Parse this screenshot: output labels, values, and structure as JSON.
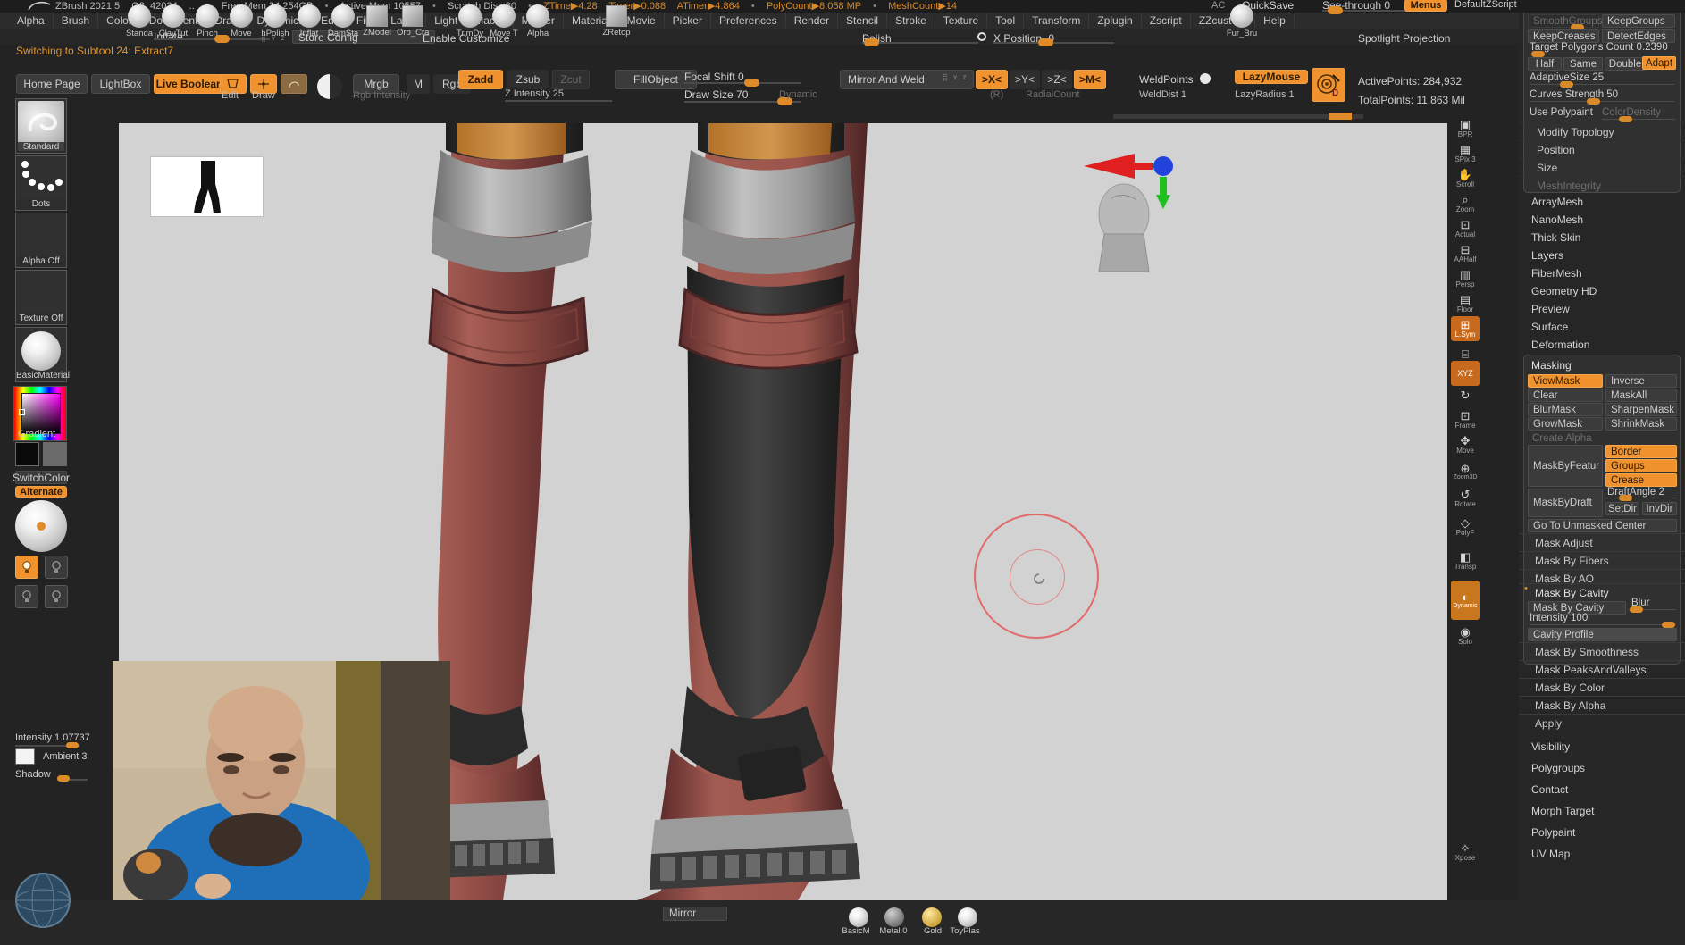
{
  "app": {
    "title_tokens": [
      "ZBrush 2021.5",
      "Q3_42024",
      "..",
      "Free Mem 34.254GB",
      "Active Mem 10557",
      "Scratch Disk 80",
      "ZTime▶4.28",
      "Timer▶0.088",
      "ATimer▶4.864",
      "PolyCount▶8.058 MP",
      "MeshCount▶14"
    ]
  },
  "menubar": {
    "items": [
      "Alpha",
      "Brush",
      "Color",
      "Document",
      "Draw",
      "Dynamics",
      "Edit",
      "File",
      "Layer",
      "Light",
      "Macro",
      "Marker",
      "Material",
      "Movie",
      "Picker",
      "Preferences",
      "Render",
      "Stencil",
      "Stroke",
      "Texture",
      "Tool",
      "Transform",
      "Zplugin",
      "Zscript",
      "ZZcustom",
      "Help"
    ]
  },
  "customrow": {
    "inflate_label": "Inflate",
    "store_config": "Store Config",
    "enable_customize": "Enable Customize",
    "polish_label": "Polish",
    "x_position_label": "X Position  -0",
    "spotlight_projection": "Spotlight Projection",
    "ac_label": "AC",
    "quicksave_label": "QuickSave",
    "see_through_label": "See-through  0",
    "menus_label": "Menus",
    "default_script_label": "DefaultZScript"
  },
  "status": {
    "message": "Switching to Subtool 24:  Extract7"
  },
  "toolbar2": {
    "home_page": "Home Page",
    "lightbox": "LightBox",
    "live_boolean": "Live Boolean",
    "edit_label": "Edit",
    "draw_label": "Draw",
    "mrgb": "Mrgb",
    "m": "M",
    "rgb": "Rgb",
    "zadd": "Zadd",
    "zsub": "Zsub",
    "zcut": "Zcut",
    "rgb_intensity": "Rgb Intensity",
    "z_intensity": "Z Intensity  25",
    "fill_object": "FillObject",
    "focal_shift": "Focal Shift  0",
    "draw_size": "Draw Size  70",
    "dynamic": "Dynamic",
    "mirror_and_weld": "Mirror And Weld",
    "axis_x": ">X<",
    "axis_y": ">Y<",
    "axis_z": ">Z<",
    "axis_m": ">M<",
    "r_label": "(R)",
    "radial_count": "RadialCount",
    "weld_points": "WeldPoints",
    "weld_dist": "WeldDist  1",
    "lazy_mouse": "LazyMouse",
    "lazy_radius": "LazyRadius  1",
    "active_points": "ActivePoints: 284,932",
    "total_points": "TotalPoints: 11.863 Mil"
  },
  "leftbar": {
    "brush_caption": "Standard",
    "stroke_caption": "Dots",
    "alpha_caption": "Alpha Off",
    "texture_caption": "Texture Off",
    "material_caption": "BasicMaterial",
    "gradient_caption": "Gradient",
    "switch_color": "SwitchColor",
    "alternate": "Alternate",
    "intensity": "Intensity  1.07737",
    "ambient": "Ambient  3",
    "shadow": "Shadow"
  },
  "rightstrip": {
    "items": [
      {
        "label": "BPR",
        "glyph": "▣"
      },
      {
        "label": "SPix 3",
        "glyph": "▦"
      },
      {
        "label": "Scroll",
        "glyph": "✋"
      },
      {
        "label": "Zoom",
        "glyph": "🔍"
      },
      {
        "label": "Actual",
        "glyph": "⊡"
      },
      {
        "label": "AAHalf",
        "glyph": "⊟"
      },
      {
        "label": "Persp",
        "glyph": "▥"
      },
      {
        "label": "Floor",
        "glyph": "▤"
      },
      {
        "label": "L.Sym",
        "glyph": "⊞",
        "on": true
      },
      {
        "label": "",
        "glyph": "🔒"
      },
      {
        "label": "XYZ",
        "glyph": "◎",
        "on": true
      },
      {
        "label": "",
        "glyph": "↻"
      },
      {
        "label": "Frame",
        "glyph": "⊡"
      },
      {
        "label": "Move",
        "glyph": "✥"
      },
      {
        "label": "Zoom3D",
        "glyph": "⊕"
      },
      {
        "label": "Rotate",
        "glyph": "↺"
      },
      {
        "label": "PolyF",
        "glyph": "◇"
      },
      {
        "label": "Transp",
        "glyph": "◧"
      },
      {
        "label": "Dynamic",
        "glyph": "◐"
      },
      {
        "label": "Solo",
        "glyph": "◉"
      },
      {
        "label": "Xpose",
        "glyph": "✧"
      }
    ]
  },
  "rightpanel": {
    "geometry": {
      "smooth_groups": "SmoothGroups",
      "keep_groups": "KeepGroups",
      "keep_creases": "KeepCreases",
      "detect_edges": "DetectEdges",
      "target_polygons_count": "Target Polygons Count  0.2390",
      "half": "Half",
      "same": "Same",
      "double": "Double",
      "adapt": "Adapt",
      "adaptive_size": "AdaptiveSize  25",
      "curves_strength": "Curves Strength  50",
      "use_polypaint": "Use Polypaint",
      "color_density": "ColorDensity",
      "modify_topology": "Modify Topology",
      "position": "Position",
      "size": "Size",
      "mesh_integrity": "MeshIntegrity"
    },
    "sections": [
      "ArrayMesh",
      "NanoMesh",
      "Thick Skin",
      "Layers",
      "FiberMesh",
      "Geometry HD",
      "Preview",
      "Surface",
      "Deformation"
    ],
    "masking": {
      "title": "Masking",
      "view_mask": "ViewMask",
      "inverse": "Inverse",
      "clear": "Clear",
      "mask_all": "MaskAll",
      "blur_mask": "BlurMask",
      "sharpen_mask": "SharpenMask",
      "grow_mask": "GrowMask",
      "shrink_mask": "ShrinkMask",
      "create_alpha": "Create Alpha",
      "mask_by_feature": "MaskByFeatur",
      "border": "Border",
      "groups": "Groups",
      "crease": "Crease",
      "mask_by_draft": "MaskByDraft",
      "draft_angle": "DraftAngle  2",
      "set_dir": "SetDir",
      "inv_dir": "InvDir",
      "go_to_unmasked_center": "Go To Unmasked Center",
      "mask_adjust": "Mask Adjust",
      "mask_by_fibers": "Mask By Fibers",
      "mask_by_ao": "Mask By AO",
      "mask_by_cavity_section": "Mask By Cavity",
      "mask_by_cavity_btn": "Mask By Cavity",
      "blur": "Blur",
      "intensity": "Intensity  100",
      "cavity_profile": "Cavity Profile",
      "mask_by_smoothness": "Mask By Smoothness",
      "mask_peaks_and_valleys": "Mask PeaksAndValleys",
      "mask_by_color": "Mask By Color",
      "mask_by_alpha": "Mask By Alpha",
      "apply": "Apply"
    },
    "footer_sections": [
      "Visibility",
      "Polygroups",
      "Contact",
      "Morph Target",
      "Polypaint",
      "UV Map"
    ]
  },
  "bottombar": {
    "brushes": [
      "Standa",
      "ClayTut",
      "Pinch",
      "Move",
      "hPolish",
      "Inflat",
      "DamSta",
      "ZModel",
      "Orb_Cra"
    ],
    "brushes2": [
      "TrimDy",
      "Move T",
      "Alpha"
    ],
    "zretop": "ZRetop",
    "fur_bru": "Fur_Bru",
    "mirror": "Mirror",
    "materials": [
      "BasicM",
      "Metal 0",
      "Gold",
      "ToyPlas"
    ]
  },
  "colors": {
    "accent": "#f0922e",
    "panel": "#303030",
    "background": "#232323",
    "canvas": "#d2d2d2",
    "status_text": "#e0952f",
    "cursor_red": "#e26a6a"
  }
}
